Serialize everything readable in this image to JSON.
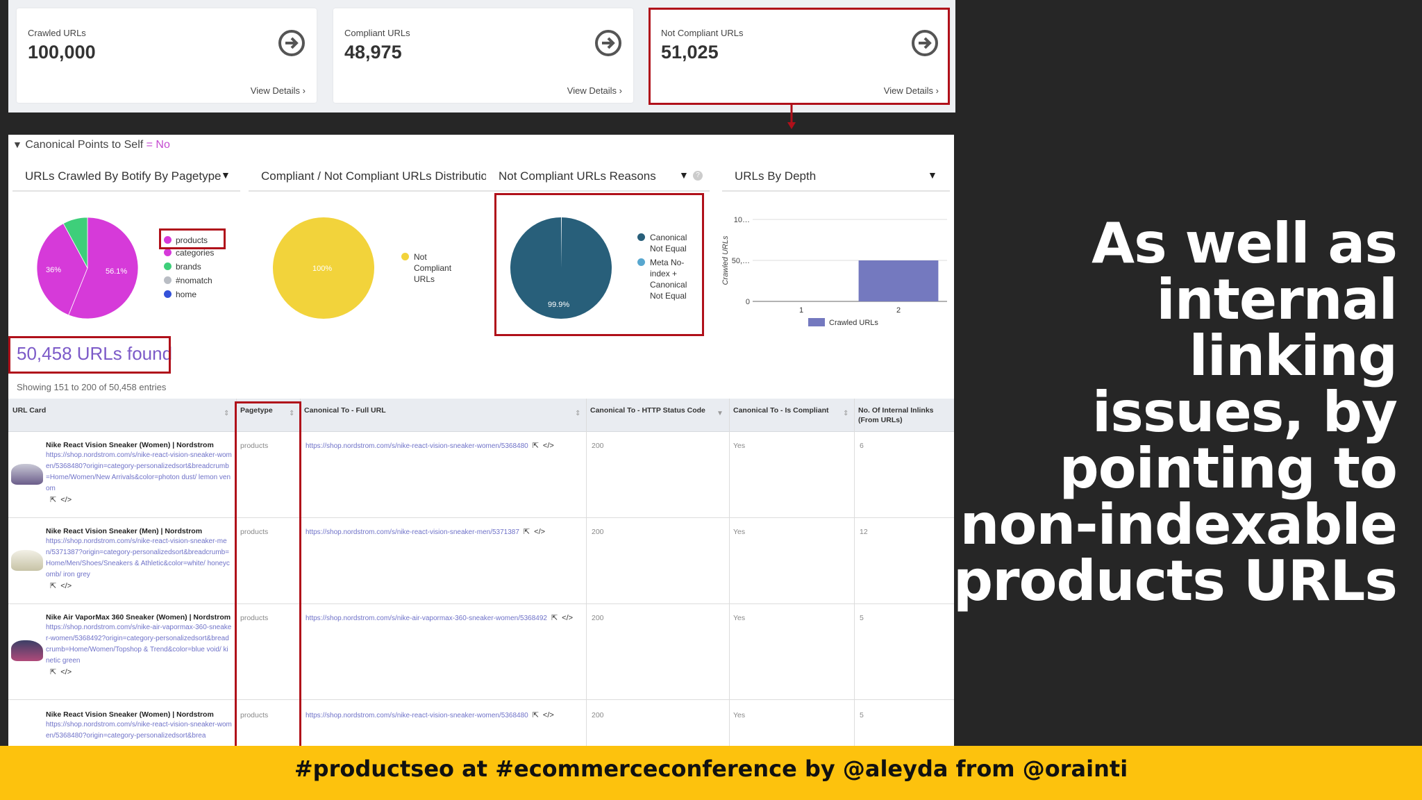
{
  "cards": [
    {
      "label": "Crawled URLs",
      "value": "100,000",
      "link": "View Details ›"
    },
    {
      "label": "Compliant URLs",
      "value": "48,975",
      "link": "View Details ›"
    },
    {
      "label": "Not Compliant URLs",
      "value": "51,025",
      "link": "View Details ›"
    }
  ],
  "filter": {
    "label": "Canonical Points to Self",
    "op": " = ",
    "value": "No"
  },
  "tabs": [
    "URLs Crawled By Botify By Pagetype",
    "Compliant / Not Compliant URLs Distribution",
    "Not Compliant URLs Reasons",
    "URLs By Depth"
  ],
  "chart_data": [
    {
      "type": "pie",
      "labels": [
        "products",
        "categories",
        "brands",
        "#nomatch",
        "home"
      ],
      "values": [
        56.1,
        36,
        7.9,
        0,
        0
      ],
      "slice_labels": [
        "56.1%",
        "36%"
      ],
      "colors": [
        "#d63ad9",
        "#d63ad9",
        "#3ecf7a",
        "#b9bdc4",
        "#3452d9"
      ]
    },
    {
      "type": "pie",
      "labels": [
        "Not Compliant URLs"
      ],
      "values": [
        100
      ],
      "slice_labels": [
        "100%"
      ],
      "colors": [
        "#f2d33b"
      ]
    },
    {
      "type": "pie",
      "labels": [
        "Canonical Not Equal",
        "Meta No-index + Canonical Not Equal"
      ],
      "values": [
        99.9,
        0.1
      ],
      "slice_labels": [
        "99.9%"
      ],
      "colors": [
        "#285f7a",
        "#58a7cf"
      ]
    },
    {
      "type": "bar",
      "categories": [
        "1",
        "2"
      ],
      "series": [
        {
          "name": "Crawled URLs",
          "values": [
            0,
            50
          ]
        }
      ],
      "ylabel": "Crawled URLs",
      "yticks": [
        "0",
        "50,…",
        "10…"
      ],
      "ylim": [
        0,
        100
      ],
      "colors": [
        "#7479bf"
      ]
    }
  ],
  "legend_pie2": "Not Compliant URLs",
  "legend_pie3": [
    "Canonical Not Equal",
    "Meta No-index + Canonical Not Equal"
  ],
  "found": "50,458 URLs found",
  "showing": "Showing 151 to 200 of 50,458 entries",
  "columns": [
    "URL Card",
    "Pagetype",
    "Canonical To - Full URL",
    "Canonical To - HTTP Status Code",
    "Canonical To - Is Compliant",
    "No. Of Internal Inlinks (From URLs)"
  ],
  "rows": [
    {
      "title": "Nike React Vision Sneaker (Women) | Nordstrom",
      "url": "https://shop.nordstrom.com/s/nike-react-vision-sneaker-women/5368480?origin=category-personalizedsort&breadcrumb=Home/Women/New Arrivals&color=photon dust/ lemon venom",
      "pagetype": "products",
      "canonical": "https://shop.nordstrom.com/s/nike-react-vision-sneaker-women/5368480",
      "status": "200",
      "compliant": "Yes",
      "inlinks": "6"
    },
    {
      "title": "Nike React Vision Sneaker (Men) | Nordstrom",
      "url": "https://shop.nordstrom.com/s/nike-react-vision-sneaker-men/5371387?origin=category-personalizedsort&breadcrumb=Home/Men/Shoes/Sneakers & Athletic&color=white/ honeycomb/ iron grey",
      "pagetype": "products",
      "canonical": "https://shop.nordstrom.com/s/nike-react-vision-sneaker-men/5371387",
      "status": "200",
      "compliant": "Yes",
      "inlinks": "12"
    },
    {
      "title": "Nike Air VaporMax 360 Sneaker (Women) | Nordstrom",
      "url": "https://shop.nordstrom.com/s/nike-air-vapormax-360-sneaker-women/5368492?origin=category-personalizedsort&breadcrumb=Home/Women/Topshop & Trend&color=blue void/ kinetic green",
      "pagetype": "products",
      "canonical": "https://shop.nordstrom.com/s/nike-air-vapormax-360-sneaker-women/5368492",
      "status": "200",
      "compliant": "Yes",
      "inlinks": "5"
    },
    {
      "title": "Nike React Vision Sneaker (Women) | Nordstrom",
      "url": "https://shop.nordstrom.com/s/nike-react-vision-sneaker-women/5368480?origin=category-personalizedsort&brea",
      "pagetype": "products",
      "canonical": "https://shop.nordstrom.com/s/nike-react-vision-sneaker-women/5368480",
      "status": "200",
      "compliant": "Yes",
      "inlinks": "5"
    }
  ],
  "slide_text": [
    "As well as",
    "internal linking",
    "issues, by",
    "pointing to",
    "non-indexable",
    "products URLs"
  ],
  "footer": "#productseo at #ecommerceconference by @aleyda from @orainti"
}
